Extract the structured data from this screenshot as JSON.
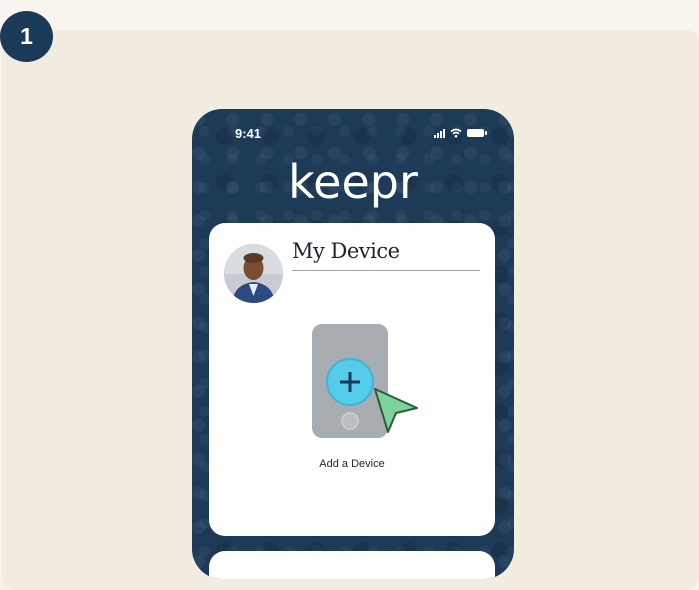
{
  "step": {
    "number": "1"
  },
  "phone": {
    "status_time": "9:41",
    "icons": [
      "signal-icon",
      "wifi-icon",
      "battery-icon"
    ],
    "logo_text": "keepr",
    "background_color": "#1d3a57"
  },
  "card": {
    "title": "My Device",
    "avatar_icon": "user-avatar",
    "add_device_icon": "plus-icon",
    "add_device_label": "Add a Device",
    "cursor_icon": "pointer-cursor-icon"
  },
  "colors": {
    "badge": "#1b3a57",
    "panel": "#f3ede1",
    "accent_plus": "#55ccea",
    "cursor": "#7ed39a"
  }
}
